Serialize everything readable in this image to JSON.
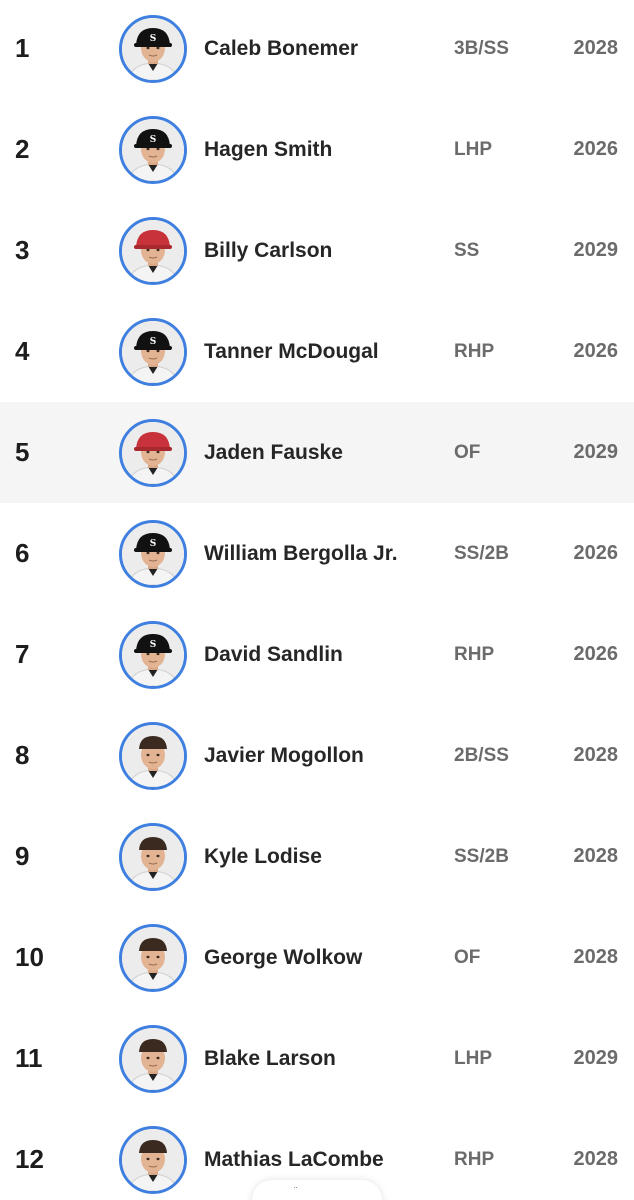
{
  "accent_color": "#3f7fe0",
  "highlight_color": "#f5f5f5",
  "prospects": [
    {
      "rank": "1",
      "name": "Caleb Bonemer",
      "position": "3B/SS",
      "eta": "2028",
      "avatar": "white-sox-cap-headshot-icon"
    },
    {
      "rank": "2",
      "name": "Hagen Smith",
      "position": "LHP",
      "eta": "2026",
      "avatar": "white-sox-cap-headshot-icon"
    },
    {
      "rank": "3",
      "name": "Billy Carlson",
      "position": "SS",
      "eta": "2029",
      "avatar": "red-cap-headshot-icon"
    },
    {
      "rank": "4",
      "name": "Tanner McDougal",
      "position": "RHP",
      "eta": "2026",
      "avatar": "white-sox-cap-headshot-icon"
    },
    {
      "rank": "5",
      "name": "Jaden Fauske",
      "position": "OF",
      "eta": "2029",
      "avatar": "red-cap-headshot-icon"
    },
    {
      "rank": "6",
      "name": "William Bergolla Jr.",
      "position": "SS/2B",
      "eta": "2026",
      "avatar": "white-sox-cap-headshot-icon"
    },
    {
      "rank": "7",
      "name": "David Sandlin",
      "position": "RHP",
      "eta": "2026",
      "avatar": "white-sox-cap-headshot-icon"
    },
    {
      "rank": "8",
      "name": "Javier Mogollon",
      "position": "2B/SS",
      "eta": "2028",
      "avatar": "no-cap-headshot-icon"
    },
    {
      "rank": "9",
      "name": "Kyle Lodise",
      "position": "SS/2B",
      "eta": "2028",
      "avatar": "no-cap-headshot-icon"
    },
    {
      "rank": "10",
      "name": "George Wolkow",
      "position": "OF",
      "eta": "2028",
      "avatar": "no-cap-headshot-icon"
    },
    {
      "rank": "11",
      "name": "Blake Larson",
      "position": "LHP",
      "eta": "2029",
      "avatar": "no-cap-headshot-icon"
    },
    {
      "rank": "12",
      "name": "Mathias LaCombe",
      "position": "RHP",
      "eta": "2028",
      "avatar": "no-cap-headshot-icon"
    }
  ]
}
